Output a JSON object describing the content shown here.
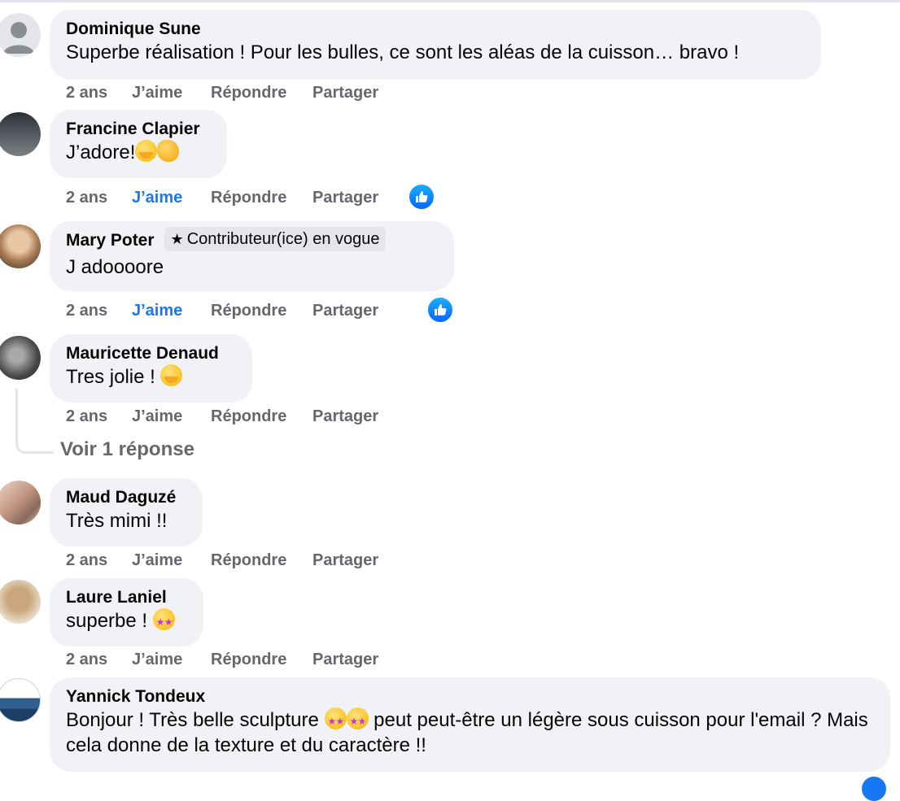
{
  "comments": [
    {
      "author": "Dominique Sune",
      "text": "Superbe réalisation ! Pour les bulles, ce sont les aléas de la cuisson… bravo !",
      "time": "2 ans",
      "like": "J’aime",
      "reply": "Répondre",
      "share": "Partager"
    },
    {
      "author": "Francine Clapier",
      "text": "J’adore!",
      "emojis": [
        "face-with-hand-over-mouth",
        "clapping-hands"
      ],
      "time": "2 ans",
      "like": "J’aime",
      "reply": "Répondre",
      "share": "Partager",
      "liked": true
    },
    {
      "author": "Mary Poter",
      "badge": "Contributeur(ice) en vogue",
      "text": "J adoooore",
      "time": "2 ans",
      "like": "J’aime",
      "reply": "Répondre",
      "share": "Partager",
      "liked": true
    },
    {
      "author": "Mauricette Denaud",
      "text": "Tres jolie !",
      "emojis": [
        "face-with-hand-over-mouth"
      ],
      "time": "2 ans",
      "like": "J’aime",
      "reply": "Répondre",
      "share": "Partager",
      "view_replies": "Voir 1 réponse"
    },
    {
      "author": "Maud Daguzé",
      "text": "Très mimi !!",
      "time": "2 ans",
      "like": "J’aime",
      "reply": "Répondre",
      "share": "Partager"
    },
    {
      "author": "Laure Laniel",
      "text": "superbe !",
      "emojis": [
        "star-struck"
      ],
      "time": "2 ans",
      "like": "J’aime",
      "reply": "Répondre",
      "share": "Partager"
    },
    {
      "author": "Yannick Tondeux",
      "text_part1": "Bonjour ! Très belle sculpture",
      "text_part2": "peut peut-être un légère sous cuisson pour l'email ? Mais cela donne de la texture et du caractère !!",
      "emojis": [
        "star-struck",
        "star-struck"
      ]
    }
  ],
  "icons": {
    "like_reaction": "thumbs-up-icon",
    "badge_icon": "star-icon"
  },
  "colors": {
    "bubble": "#f0f2f5",
    "muted": "#65676b",
    "liked": "#1877f2"
  }
}
